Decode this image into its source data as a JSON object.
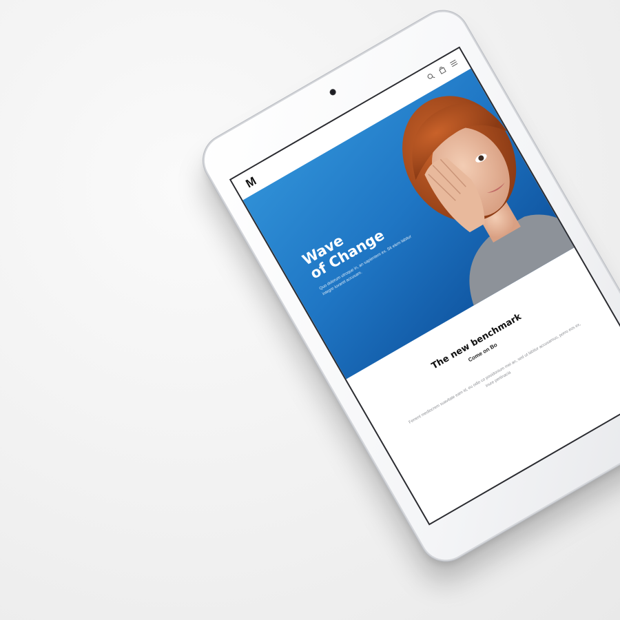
{
  "site": {
    "logo_text": "M",
    "icons": [
      "search-icon",
      "shopping-bag-icon",
      "menu-icon"
    ]
  },
  "hero": {
    "title_line1": "Wave",
    "title_line2": "of Change",
    "subtitle": "Quo dolorum utroque in, an sapientem ex. Sit elem labitur integre iuvaret accusam.",
    "background_color": "#1f76c4"
  },
  "section": {
    "title": "The new benchmark",
    "subtitle": "Come on Bo",
    "body": "Ferrent mediocrem suavitate eam id, eu odio co posidonium mei an, sed ut labitur accusamus, porro eos ex, inure pertinacia"
  },
  "colors": {
    "accent": "#1f76c4",
    "text_dark": "#111111",
    "text_muted": "#8b8d92"
  }
}
